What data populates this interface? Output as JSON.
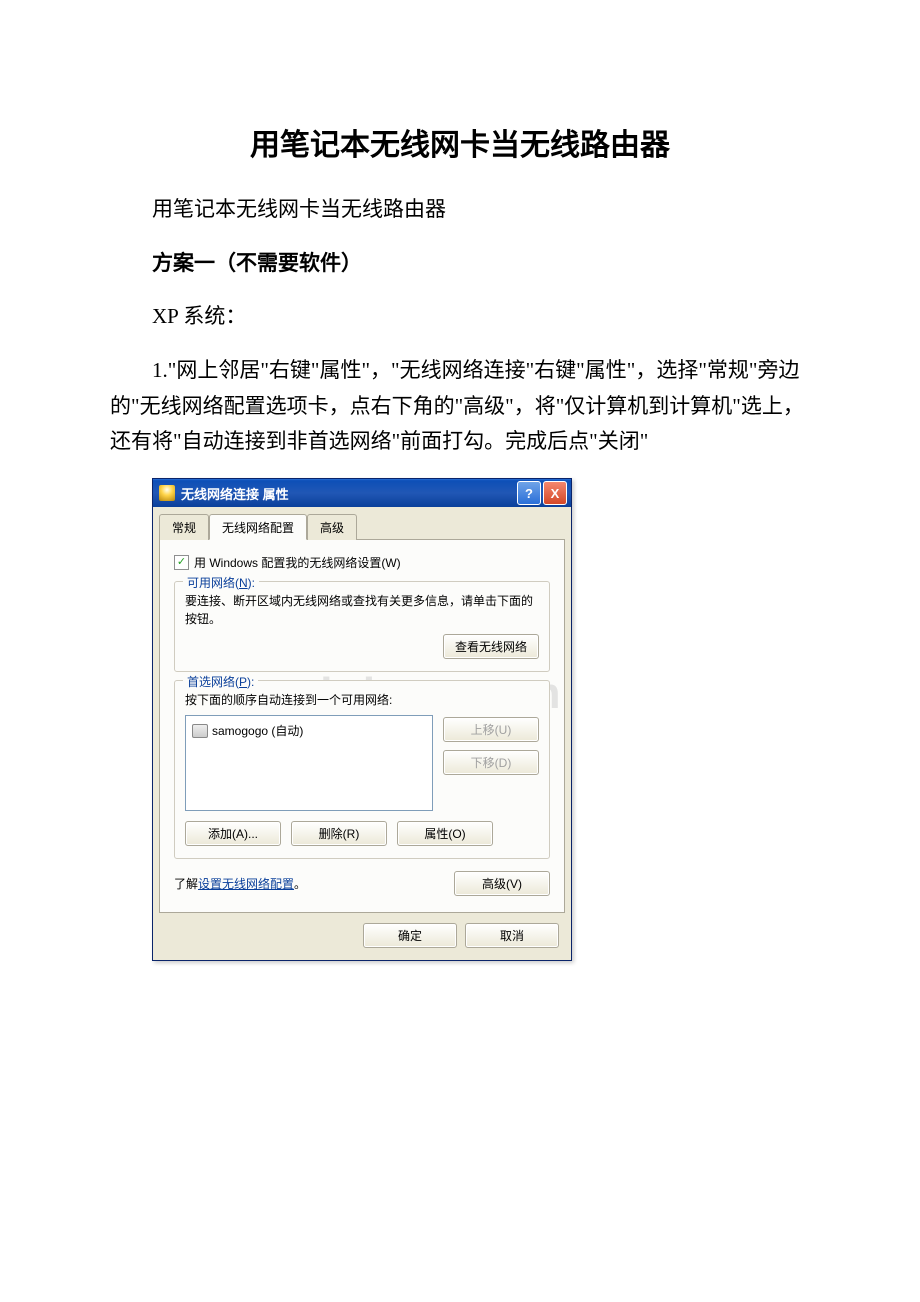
{
  "doc": {
    "title": "用笔记本无线网卡当无线路由器",
    "subtitle": "用笔记本无线网卡当无线路由器",
    "plan_heading": "方案一（不需要软件）",
    "os_line": "XP 系统：",
    "step1": "1.\"网上邻居\"右键\"属性\"，\"无线网络连接\"右键\"属性\"，选择\"常规\"旁边的\"无线网络配置选项卡，点右下角的\"高级\"，将\"仅计算机到计算机\"选上，还有将\"自动连接到非首选网络\"前面打勾。完成后点\"关闭\""
  },
  "dialog": {
    "title": "无线网络连接 属性",
    "tabs": {
      "general": "常规",
      "wireless": "无线网络配置",
      "advanced": "高级"
    },
    "use_windows_label": "用 Windows 配置我的无线网络设置(W)",
    "available": {
      "legend_prefix": "可用网络(",
      "legend_key": "N",
      "legend_suffix": "):",
      "text": "要连接、断开区域内无线网络或查找有关更多信息，请单击下面的按钮。",
      "view_btn": "查看无线网络"
    },
    "preferred": {
      "legend_prefix": "首选网络(",
      "legend_key": "P",
      "legend_suffix": "):",
      "text": "按下面的顺序自动连接到一个可用网络:",
      "item": "samogogo (自动)",
      "up_btn": "上移(U)",
      "down_btn": "下移(D)",
      "add_btn": "添加(A)...",
      "remove_btn": "删除(R)",
      "props_btn": "属性(O)"
    },
    "learn_prefix": "了解",
    "learn_link": "设置无线网络配置",
    "learn_suffix": "。",
    "adv_btn": "高级(V)",
    "ok": "确定",
    "cancel": "取消"
  },
  "watermark": "www.bdocx.com"
}
